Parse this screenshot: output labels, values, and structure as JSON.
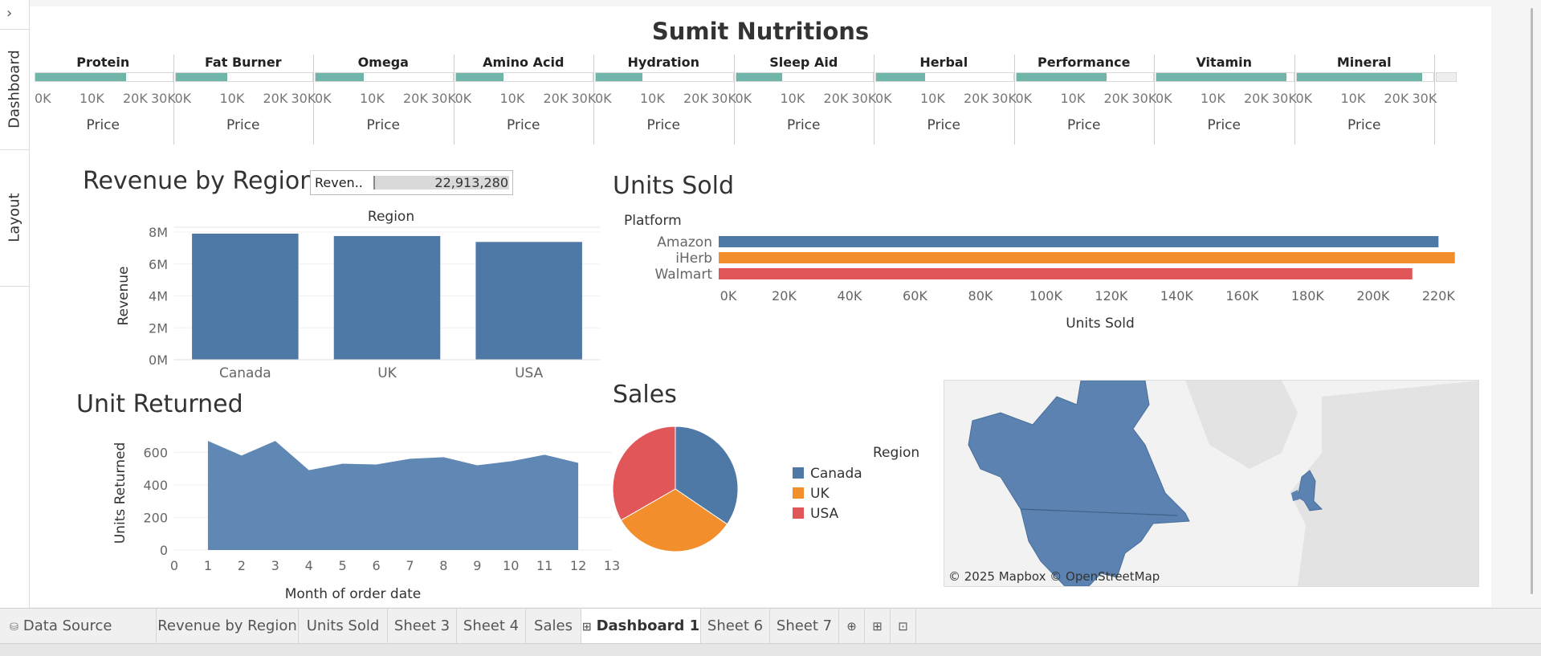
{
  "rail": {
    "toggle": "›",
    "tabs": [
      "Dashboard",
      "Layout"
    ]
  },
  "dashboard": {
    "title": "Sumit Nutritions"
  },
  "categories": {
    "names": [
      "Protein",
      "Fat Burner",
      "Omega",
      "Amino Acid",
      "Hydration",
      "Sleep Aid",
      "Herbal",
      "Performance",
      "Vitamin",
      "Mineral"
    ],
    "price_fraction": [
      0.66,
      0.38,
      0.35,
      0.35,
      0.34,
      0.34,
      0.36,
      0.66,
      0.95,
      0.92
    ],
    "ticks": [
      "0K",
      "10K",
      "20K",
      "30K"
    ],
    "axis_label": "Price",
    "bar_color": "#6fb5a9"
  },
  "revenue_by_region": {
    "title": "Revenue by Region",
    "kpi": {
      "label": "Reven..",
      "value": "22,913,280"
    },
    "chart_data": {
      "type": "bar",
      "title": "",
      "header": "Region",
      "categories": [
        "Canada",
        "UK",
        "USA"
      ],
      "values": [
        7900000,
        7750000,
        7380000
      ],
      "ylabel": "Revenue",
      "yticks": [
        "0M",
        "2M",
        "4M",
        "6M",
        "8M"
      ],
      "ylim": [
        0,
        8000000
      ],
      "color": "#4e79a7"
    }
  },
  "units_sold": {
    "title": "Units Sold",
    "chart_data": {
      "type": "bar",
      "orientation": "horizontal",
      "header": "Platform",
      "categories": [
        "Amazon",
        "iHerb",
        "Walmart"
      ],
      "values": [
        220000,
        225000,
        212000
      ],
      "colors": [
        "#4e79a7",
        "#f28e2b",
        "#e15759"
      ],
      "xlabel": "Units Sold",
      "xticks": [
        "0K",
        "20K",
        "40K",
        "60K",
        "80K",
        "100K",
        "120K",
        "140K",
        "160K",
        "180K",
        "200K",
        "220K"
      ],
      "xlim": [
        0,
        220000
      ]
    }
  },
  "unit_returned": {
    "title": "Unit Returned",
    "chart_data": {
      "type": "area",
      "x": [
        1,
        2,
        3,
        4,
        5,
        6,
        7,
        8,
        9,
        10,
        11,
        12
      ],
      "values": [
        670,
        580,
        670,
        490,
        530,
        525,
        560,
        570,
        520,
        545,
        585,
        535
      ],
      "xlabel": "Month of order date",
      "ylabel": "Units Returned",
      "xticks": [
        "0",
        "1",
        "2",
        "3",
        "4",
        "5",
        "6",
        "7",
        "8",
        "9",
        "10",
        "11",
        "12",
        "13"
      ],
      "yticks": [
        "0",
        "200",
        "400",
        "600"
      ],
      "xlim": [
        0,
        13
      ],
      "ylim": [
        0,
        700
      ],
      "color": "#6088b4"
    }
  },
  "sales": {
    "title": "Sales",
    "chart_data": {
      "type": "pie",
      "categories": [
        "Canada",
        "UK",
        "USA"
      ],
      "values": [
        34.5,
        32.2,
        33.3
      ],
      "colors": [
        "#4e79a7",
        "#f28e2b",
        "#e15759"
      ]
    },
    "legend": {
      "title": "Region",
      "items": [
        {
          "label": "Canada",
          "color": "#4e79a7"
        },
        {
          "label": "UK",
          "color": "#f28e2b"
        },
        {
          "label": "USA",
          "color": "#e15759"
        }
      ]
    }
  },
  "map": {
    "credit": "© 2025 Mapbox © OpenStreetMap",
    "land_color": "#5b82b0"
  },
  "sheet_tabs": [
    "Data Source",
    "Revenue by Region",
    "Units Sold",
    "Sheet 3",
    "Sheet 4",
    "Sales",
    "Dashboard 1",
    "Sheet 6",
    "Sheet 7"
  ],
  "active_tab": "Dashboard 1"
}
